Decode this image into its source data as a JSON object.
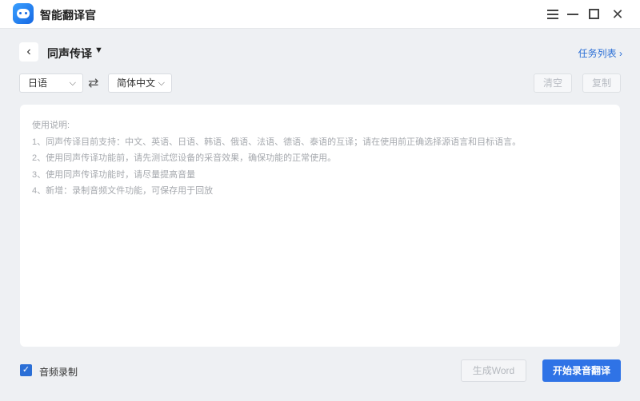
{
  "app": {
    "title": "智能翻译官"
  },
  "header": {
    "mode": "同声传译",
    "task_list": "任务列表"
  },
  "languages": {
    "source": "日语",
    "target": "简体中文"
  },
  "toolbar": {
    "clear": "清空",
    "copy": "复制"
  },
  "instructions": {
    "heading": "使用说明:",
    "lines": [
      "1、同声传译目前支持：中文、英语、日语、韩语、俄语、法语、德语、泰语的互译；请在使用前正确选择源语言和目标语言。",
      "2、使用同声传译功能前，请先测试您设备的采音效果，确保功能的正常使用。",
      "3、使用同声传译功能时，请尽量提高音量",
      "4、新增：录制音频文件功能，可保存用于回放"
    ]
  },
  "footer": {
    "record_audio": "音频录制",
    "record_checked": true,
    "generate_word": "生成Word",
    "start": "开始录音翻译"
  },
  "colors": {
    "accent": "#2f73e6",
    "link": "#2b6fd6"
  },
  "icons": {
    "back": "chevron-left-icon",
    "caret": "caret-down-icon",
    "swap": "swap-icon",
    "menu": "menu-icon",
    "minimize": "minimize-icon",
    "maximize": "maximize-icon",
    "close": "close-icon"
  }
}
